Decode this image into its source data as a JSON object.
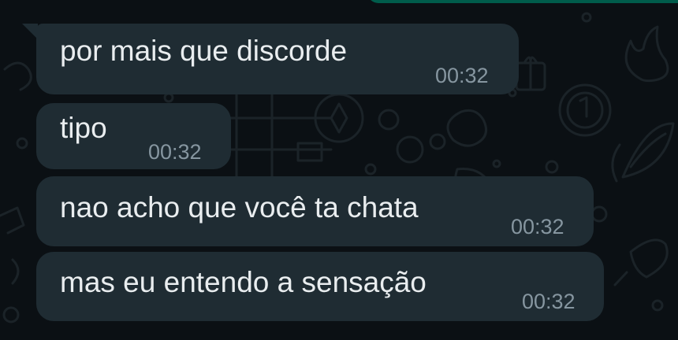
{
  "conversation": {
    "messages": [
      {
        "text": "por mais que discorde",
        "time": "00:32"
      },
      {
        "text": "tipo",
        "time": "00:32"
      },
      {
        "text": "nao acho que você ta chata",
        "time": "00:32"
      },
      {
        "text": "mas eu entendo a sensação",
        "time": "00:32"
      }
    ]
  },
  "colors": {
    "background": "#0b1014",
    "incoming_bubble": "#1f2c33",
    "outgoing_bubble": "#005c4b",
    "message_text": "#e9edef",
    "timestamp_text": "#8696a0",
    "wallpaper_doodles": "#1b2328"
  }
}
